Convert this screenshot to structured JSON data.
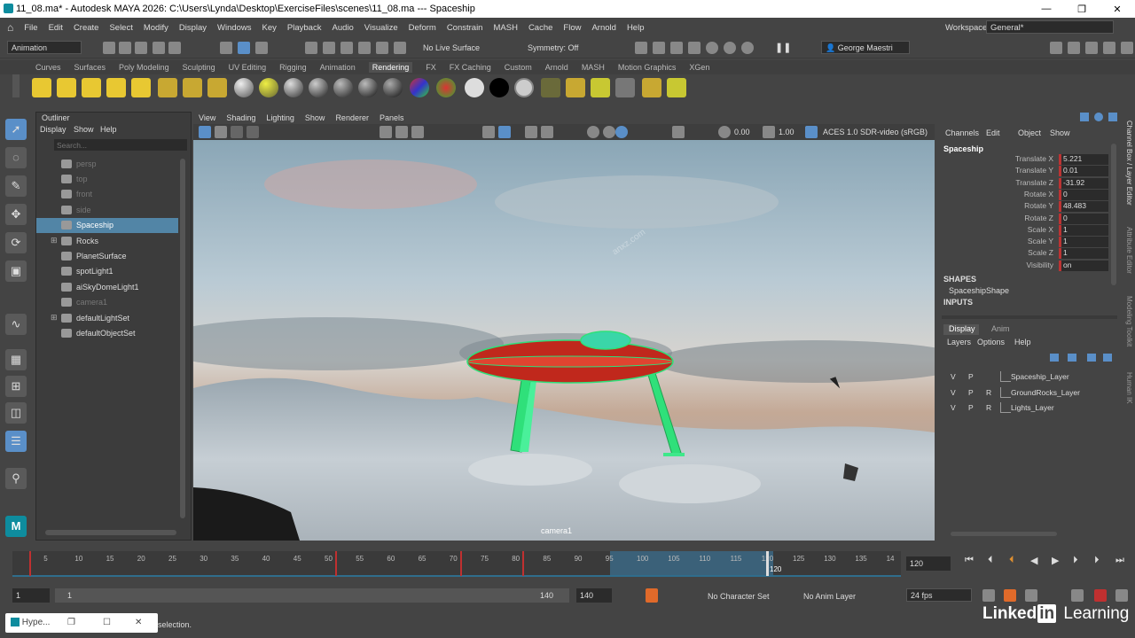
{
  "window": {
    "title": "11_08.ma* - Autodesk MAYA 2026: C:\\Users\\Lynda\\Desktop\\ExerciseFiles\\scenes\\11_08.ma  ---  Spaceship",
    "minimize": "—",
    "maximize": "❐",
    "close": "✕"
  },
  "menubar": {
    "items": [
      "File",
      "Edit",
      "Create",
      "Select",
      "Modify",
      "Display",
      "Windows",
      "Key",
      "Playback",
      "Audio",
      "Visualize",
      "Deform",
      "Constrain",
      "MASH",
      "Cache",
      "Flow",
      "Arnold",
      "Help"
    ],
    "workspace_label": "Workspace:",
    "workspace_value": "General*"
  },
  "statusline": {
    "menuset": "Animation",
    "live_surface": "No Live Surface",
    "symmetry": "Symmetry: Off",
    "user": "George Maestri"
  },
  "shelf_tabs": [
    "Curves",
    "Surfaces",
    "Poly Modeling",
    "Sculpting",
    "UV Editing",
    "Rigging",
    "Animation",
    "Rendering",
    "FX",
    "FX Caching",
    "Custom",
    "Arnold",
    "MASH",
    "Motion Graphics",
    "XGen"
  ],
  "outliner": {
    "title": "Outliner",
    "menu": [
      "Display",
      "Show",
      "Help"
    ],
    "search_placeholder": "Search...",
    "items": [
      {
        "label": "persp",
        "dim": true
      },
      {
        "label": "top",
        "dim": true
      },
      {
        "label": "front",
        "dim": true
      },
      {
        "label": "side",
        "dim": true
      },
      {
        "label": "Spaceship",
        "selected": true
      },
      {
        "label": "Rocks",
        "expand": "+"
      },
      {
        "label": "PlanetSurface"
      },
      {
        "label": "spotLight1"
      },
      {
        "label": "aiSkyDomeLight1"
      },
      {
        "label": "camera1",
        "dim": true
      },
      {
        "label": "defaultLightSet",
        "expand": "+"
      },
      {
        "label": "defaultObjectSet"
      }
    ]
  },
  "viewport": {
    "menu": [
      "View",
      "Shading",
      "Lighting",
      "Show",
      "Renderer",
      "Panels"
    ],
    "exposure": "0.00",
    "gamma": "1.00",
    "colorspace": "ACES 1.0 SDR-video (sRGB)",
    "camera_label": "camera1",
    "watermark": "anxz.com"
  },
  "channels": {
    "menu": [
      "Channels",
      "Edit",
      "Object",
      "Show"
    ],
    "object": "Spaceship",
    "attrs": [
      {
        "name": "Translate X",
        "value": "5.221"
      },
      {
        "name": "Translate Y",
        "value": "0.01"
      },
      {
        "name": "Translate Z",
        "value": "-31.92"
      },
      {
        "name": "Rotate X",
        "value": "0"
      },
      {
        "name": "Rotate Y",
        "value": "48.483"
      },
      {
        "name": "Rotate Z",
        "value": "0"
      },
      {
        "name": "Scale X",
        "value": "1"
      },
      {
        "name": "Scale Y",
        "value": "1"
      },
      {
        "name": "Scale Z",
        "value": "1"
      },
      {
        "name": "Visibility",
        "value": "on"
      }
    ],
    "shapes_header": "SHAPES",
    "shape": "SpaceshipShape",
    "inputs_header": "INPUTS"
  },
  "layers": {
    "tabs": [
      "Display",
      "Anim"
    ],
    "menu": [
      "Layers",
      "Options",
      "Help"
    ],
    "rows": [
      {
        "v": "V",
        "p": "P",
        "r": "",
        "name": "Spaceship_Layer"
      },
      {
        "v": "V",
        "p": "P",
        "r": "R",
        "name": "GroundRocks_Layer"
      },
      {
        "v": "V",
        "p": "P",
        "r": "R",
        "name": "Lights_Layer"
      }
    ]
  },
  "side_tabs": [
    "Channel Box / Layer Editor",
    "Attribute Editor",
    "Modeling Toolkit",
    "Human IK"
  ],
  "timeline": {
    "ticks": [
      "5",
      "10",
      "15",
      "20",
      "25",
      "30",
      "35",
      "40",
      "45",
      "50",
      "55",
      "60",
      "65",
      "70",
      "75",
      "80",
      "85",
      "90",
      "95",
      "100",
      "105",
      "110",
      "115",
      "120",
      "125",
      "130",
      "135",
      "14"
    ],
    "current_frame": "120",
    "current_frame_marker": "120",
    "keyframes": [
      1,
      50,
      70,
      80
    ]
  },
  "range": {
    "start": "1",
    "inner_start": "1",
    "inner_end": "140",
    "end": "140",
    "char_set": "No Character Set",
    "anim_layer": "No Anim Layer",
    "fps": "24 fps"
  },
  "taskbar": {
    "app": "Hype...",
    "help_text": "selection."
  },
  "branding": {
    "linkedin": "Linked",
    "in": "in",
    "learning": "Learning"
  }
}
